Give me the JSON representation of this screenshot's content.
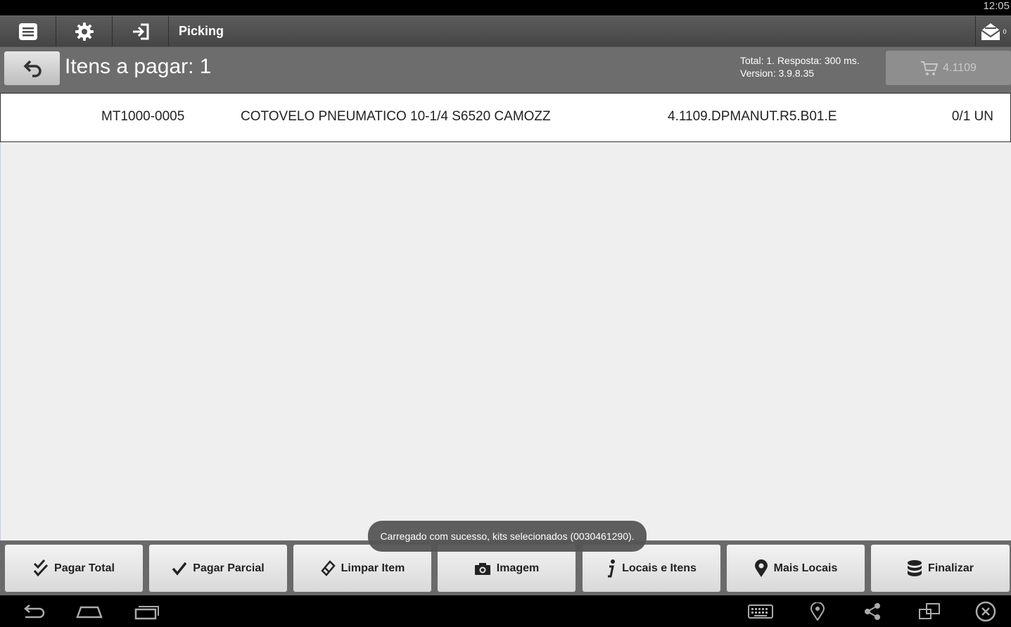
{
  "status_bar": {
    "time": "12:05"
  },
  "action_bar": {
    "title": "Picking",
    "icons": [
      "menu-icon",
      "gear-icon",
      "login-icon",
      "mail-icon"
    ],
    "mail_count": "0"
  },
  "sub_header": {
    "title": "Itens a pagar: 1",
    "info_line1": "Total: 1. Resposta: 300 ms.",
    "info_line2": "Version: 3.9.8.35",
    "cart_label": "4.1109"
  },
  "items": [
    {
      "code": "MT1000-0005",
      "description": "COTOVELO PNEUMATICO 10-1/4 S6520 CAMOZZ",
      "location": "4.1109.DPMANUT.R5.B01.E",
      "quantity": "0/1 UN"
    }
  ],
  "toast": "Carregado com sucesso, kits selecionados (0030461290).",
  "toolbar": {
    "pagar_total": "Pagar Total",
    "pagar_parcial": "Pagar Parcial",
    "limpar_item": "Limpar Item",
    "imagem": "Imagem",
    "locais_itens": "Locais e Itens",
    "mais_locais": "Mais Locais",
    "finalizar": "Finalizar"
  },
  "colors": {
    "action_bar": "#4f4f4f",
    "sub_header": "#6d6d6d",
    "toolbar": "#6a6a6a",
    "button": "#e6e6e6"
  }
}
